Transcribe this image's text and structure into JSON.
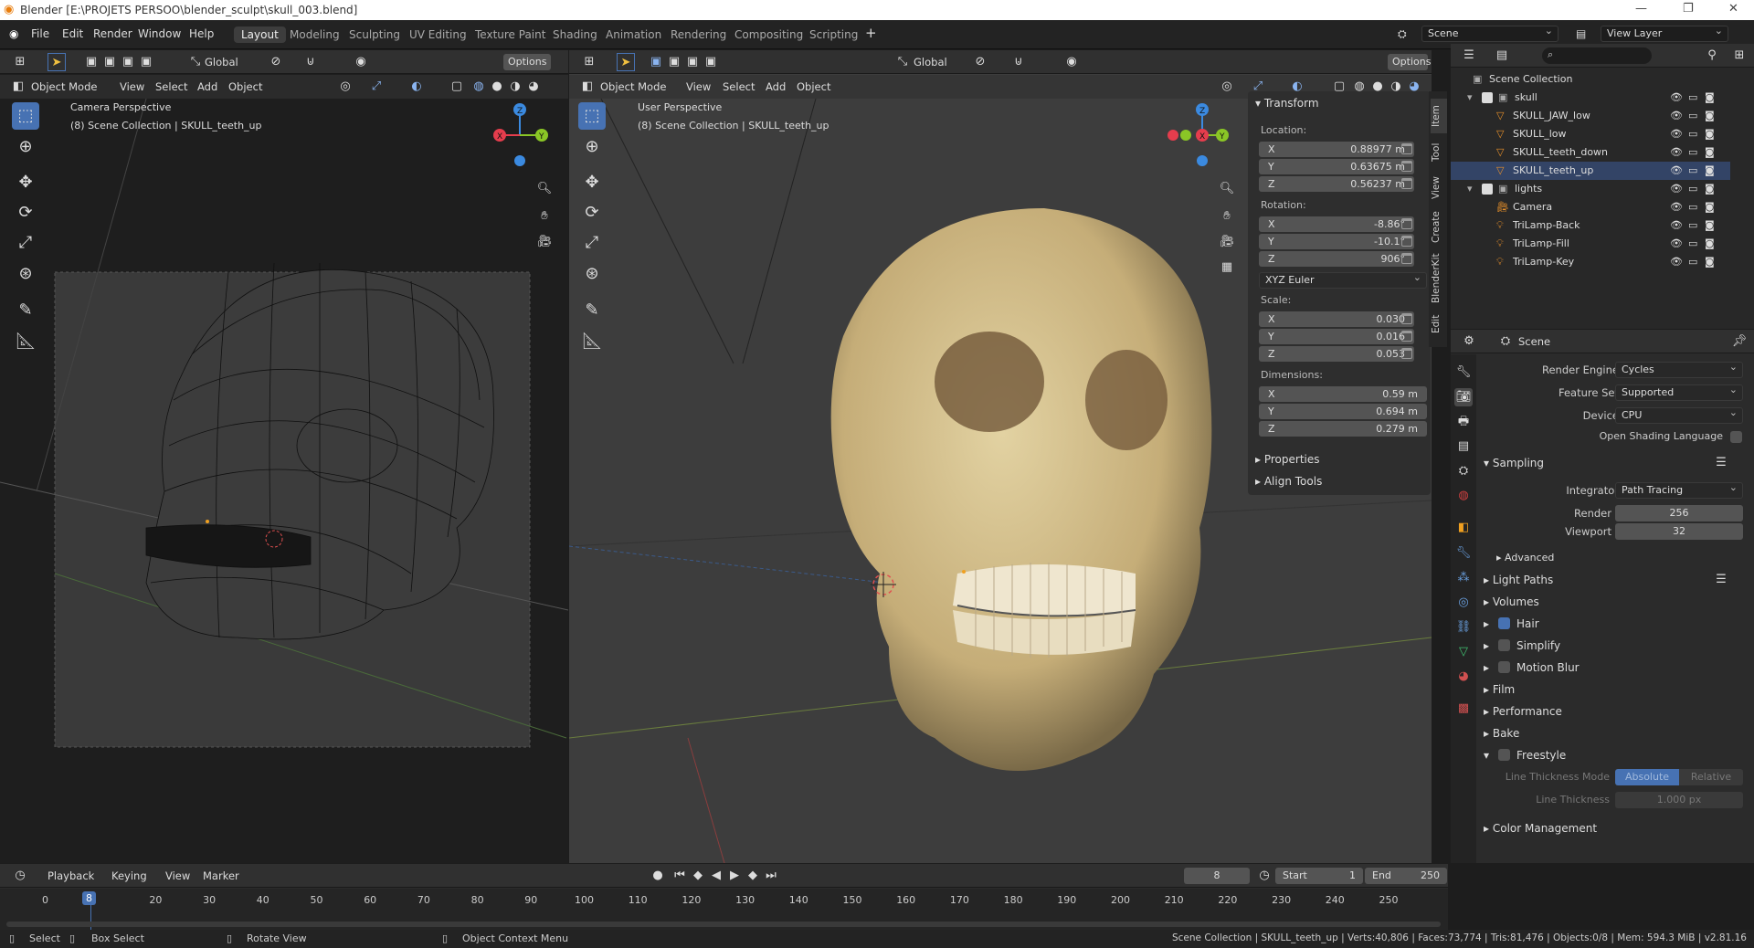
{
  "window": {
    "title": "Blender [E:\\PROJETS PERSOO\\blender_sculpt\\skull_003.blend]"
  },
  "menu": [
    "File",
    "Edit",
    "Render",
    "Window",
    "Help"
  ],
  "workspaces": [
    "Layout",
    "Modeling",
    "Sculpting",
    "UV Editing",
    "Texture Paint",
    "Shading",
    "Animation",
    "Rendering",
    "Compositing",
    "Scripting"
  ],
  "scene_name": "Scene",
  "view_layer": "View Layer",
  "left_view": {
    "transform": "Global",
    "options": "Options",
    "mode": "Object Mode",
    "menus": [
      "View",
      "Select",
      "Add",
      "Object"
    ],
    "title": "Camera Perspective",
    "subtitle": "(8) Scene Collection | SKULL_teeth_up"
  },
  "main_view": {
    "transform": "Global",
    "options": "Options",
    "mode": "Object Mode",
    "menus": [
      "View",
      "Select",
      "Add",
      "Object"
    ],
    "title": "User Perspective",
    "subtitle": "(8) Scene Collection | SKULL_teeth_up"
  },
  "npanel": {
    "header": "Transform",
    "location_label": "Location:",
    "location": [
      "0.88977 m",
      "0.63675 m",
      "0.56237 m"
    ],
    "rotation_label": "Rotation:",
    "rotation": [
      "-8.86°",
      "-10.1°",
      "906°"
    ],
    "rotation_mode": "XYZ Euler",
    "scale_label": "Scale:",
    "scale": [
      "0.030",
      "0.016",
      "0.053"
    ],
    "dimensions_label": "Dimensions:",
    "dimensions": [
      "0.59 m",
      "0.694 m",
      "0.279 m"
    ],
    "axes": [
      "X",
      "Y",
      "Z"
    ],
    "properties": "Properties",
    "align_tools": "Align Tools",
    "tabs": [
      "Item",
      "Tool",
      "View",
      "Create",
      "BlenderKit",
      "Edit"
    ]
  },
  "outliner": {
    "root": "Scene Collection",
    "items": [
      {
        "label": "skull",
        "level": 1,
        "type": "collection"
      },
      {
        "label": "SKULL_JAW_low",
        "level": 2,
        "type": "mesh"
      },
      {
        "label": "SKULL_low",
        "level": 2,
        "type": "mesh"
      },
      {
        "label": "SKULL_teeth_down",
        "level": 2,
        "type": "mesh"
      },
      {
        "label": "SKULL_teeth_up",
        "level": 2,
        "type": "mesh"
      },
      {
        "label": "lights",
        "level": 1,
        "type": "collection"
      },
      {
        "label": "Camera",
        "level": 2,
        "type": "camera"
      },
      {
        "label": "TriLamp-Back",
        "level": 2,
        "type": "light"
      },
      {
        "label": "TriLamp-Fill",
        "level": 2,
        "type": "light"
      },
      {
        "label": "TriLamp-Key",
        "level": 2,
        "type": "light"
      }
    ]
  },
  "properties": {
    "header": "Scene",
    "render_engine_label": "Render Engine",
    "render_engine": "Cycles",
    "feature_set_label": "Feature Set",
    "feature_set": "Supported",
    "device_label": "Device",
    "device": "CPU",
    "osl_label": "Open Shading Language",
    "sampling": "Sampling",
    "integrator_label": "Integrator",
    "integrator": "Path Tracing",
    "render_label": "Render",
    "render_samples": "256",
    "viewport_label": "Viewport",
    "viewport_samples": "32",
    "advanced": "Advanced",
    "light_paths": "Light Paths",
    "volumes": "Volumes",
    "hair": "Hair",
    "simplify": "Simplify",
    "motion_blur": "Motion Blur",
    "film": "Film",
    "performance": "Performance",
    "bake": "Bake",
    "freestyle": "Freestyle",
    "line_thickness_mode_label": "Line Thickness Mode",
    "absolute": "Absolute",
    "relative": "Relative",
    "line_thickness_label": "Line Thickness",
    "line_thickness": "1.000 px",
    "color_management": "Color Management"
  },
  "timeline": {
    "menus": [
      "Playback",
      "Keying",
      "View",
      "Marker"
    ],
    "current_frame": "8",
    "start_label": "Start",
    "start": "1",
    "end_label": "End",
    "end": "250",
    "ticks": [
      "0",
      "8",
      "20",
      "30",
      "40",
      "50",
      "60",
      "70",
      "80",
      "90",
      "100",
      "110",
      "120",
      "130",
      "140",
      "150",
      "160",
      "170",
      "180",
      "190",
      "200",
      "210",
      "220",
      "230",
      "240",
      "250"
    ]
  },
  "status": {
    "select": "Select",
    "box_select": "Box Select",
    "rotate_view": "Rotate View",
    "context_menu": "Object Context Menu",
    "stats": "Scene Collection | SKULL_teeth_up | Verts:40,806 | Faces:73,774 | Tris:81,476 | Objects:0/8 | Mem: 594.3 MiB | v2.81.16"
  },
  "colors": {
    "accent": "#4772b3",
    "x_axis": "#e53d4d",
    "y_axis": "#8ac626",
    "z_axis": "#3b8ae0",
    "skull": "#cdb98a"
  }
}
